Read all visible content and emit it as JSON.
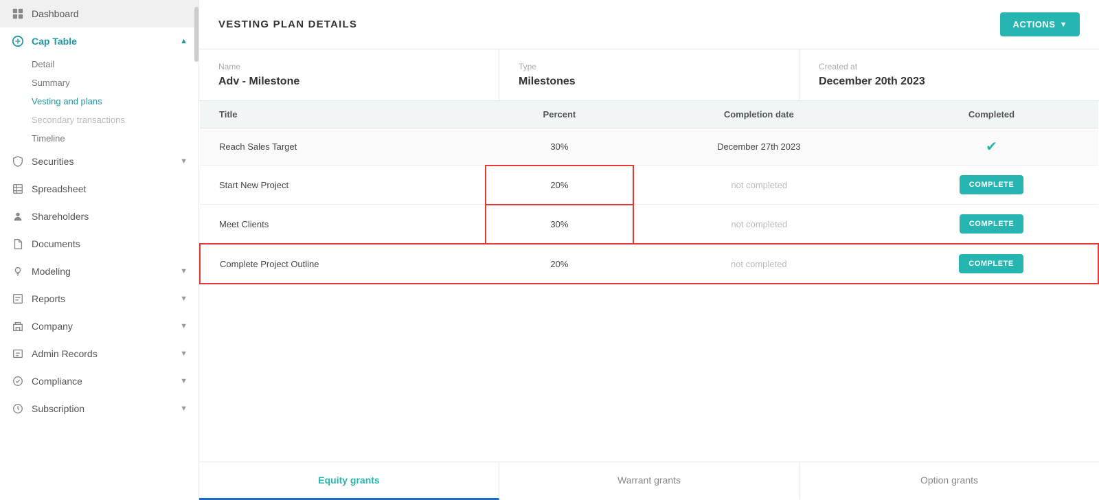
{
  "sidebar": {
    "items": [
      {
        "id": "dashboard",
        "label": "Dashboard",
        "icon": "grid",
        "hasChevron": false,
        "expanded": false
      },
      {
        "id": "cap-table",
        "label": "Cap Table",
        "icon": "table",
        "hasChevron": true,
        "expanded": true
      },
      {
        "id": "securities",
        "label": "Securities",
        "icon": "shield",
        "hasChevron": true,
        "expanded": false
      },
      {
        "id": "spreadsheet",
        "label": "Spreadsheet",
        "icon": "sheet",
        "hasChevron": false,
        "expanded": false
      },
      {
        "id": "shareholders",
        "label": "Shareholders",
        "icon": "person",
        "hasChevron": false,
        "expanded": false
      },
      {
        "id": "documents",
        "label": "Documents",
        "icon": "doc",
        "hasChevron": false,
        "expanded": false
      },
      {
        "id": "modeling",
        "label": "Modeling",
        "icon": "bulb",
        "hasChevron": true,
        "expanded": false
      },
      {
        "id": "reports",
        "label": "Reports",
        "icon": "report",
        "hasChevron": true,
        "expanded": false
      },
      {
        "id": "company",
        "label": "Company",
        "icon": "building",
        "hasChevron": true,
        "expanded": false
      },
      {
        "id": "admin-records",
        "label": "Admin Records",
        "icon": "admin",
        "hasChevron": true,
        "expanded": false
      },
      {
        "id": "compliance",
        "label": "Compliance",
        "icon": "compliance",
        "hasChevron": true,
        "expanded": false
      },
      {
        "id": "subscription",
        "label": "Subscription",
        "icon": "subscription",
        "hasChevron": true,
        "expanded": false
      }
    ],
    "sub_items": [
      {
        "label": "Detail",
        "active": false,
        "disabled": false
      },
      {
        "label": "Summary",
        "active": false,
        "disabled": false
      },
      {
        "label": "Vesting and plans",
        "active": true,
        "disabled": false
      },
      {
        "label": "Secondary transactions",
        "active": false,
        "disabled": true
      },
      {
        "label": "Timeline",
        "active": false,
        "disabled": false
      }
    ]
  },
  "header": {
    "title": "VESTING PLAN DETAILS",
    "actions_label": "ACTIONS"
  },
  "info": {
    "name_label": "Name",
    "name_value": "Adv - Milestone",
    "type_label": "Type",
    "type_value": "Milestones",
    "created_label": "Created at",
    "created_value": "December 20th 2023"
  },
  "table": {
    "columns": [
      "Title",
      "Percent",
      "Completion date",
      "Completed"
    ],
    "rows": [
      {
        "title": "Reach Sales Target",
        "percent": "30%",
        "completion": "December 27th 2023",
        "status": "done",
        "btn_label": ""
      },
      {
        "title": "Start New Project",
        "percent": "20%",
        "completion": "not completed",
        "status": "incomplete",
        "btn_label": "COMPLETE",
        "red_cell": true
      },
      {
        "title": "Meet Clients",
        "percent": "30%",
        "completion": "not completed",
        "status": "incomplete",
        "btn_label": "COMPLETE",
        "red_cell": true
      },
      {
        "title": "Complete Project Outline",
        "percent": "20%",
        "completion": "not completed",
        "status": "incomplete",
        "btn_label": "COMPLETE",
        "red_row": true
      }
    ]
  },
  "tabs": [
    {
      "id": "equity-grants",
      "label": "Equity grants",
      "active": true
    },
    {
      "id": "warrant-grants",
      "label": "Warrant grants",
      "active": false
    },
    {
      "id": "option-grants",
      "label": "Option grants",
      "active": false
    }
  ]
}
